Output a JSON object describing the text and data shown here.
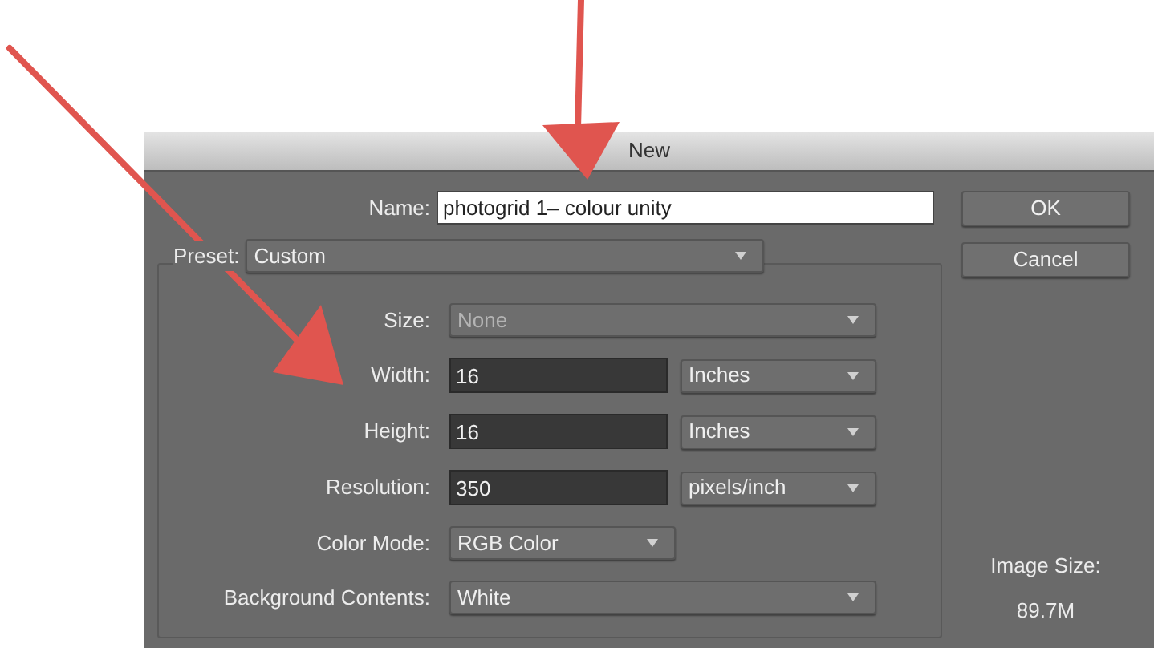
{
  "window": {
    "title": "New"
  },
  "name": {
    "label": "Name:",
    "value": "photogrid 1– colour unity"
  },
  "preset": {
    "label": "Preset:",
    "value": "Custom"
  },
  "fields": [
    {
      "kind": "select",
      "label": "Size:",
      "value": "None",
      "disabled": true
    },
    {
      "kind": "number",
      "label": "Width:",
      "value": "16",
      "unit": "Inches",
      "disabled": false
    },
    {
      "kind": "number",
      "label": "Height:",
      "value": "16",
      "unit": "Inches",
      "disabled": false
    },
    {
      "kind": "number",
      "label": "Resolution:",
      "value": "350",
      "unit": "pixels/inch",
      "disabled": false
    },
    {
      "kind": "short_select",
      "label": "Color Mode:",
      "value": "RGB Color",
      "disabled": false
    },
    {
      "kind": "select",
      "label": "Background Contents:",
      "value": "White",
      "disabled": false
    }
  ],
  "buttons": [
    "OK",
    "Cancel"
  ],
  "image_size": {
    "label": "Image Size:",
    "value": "89.7M"
  }
}
